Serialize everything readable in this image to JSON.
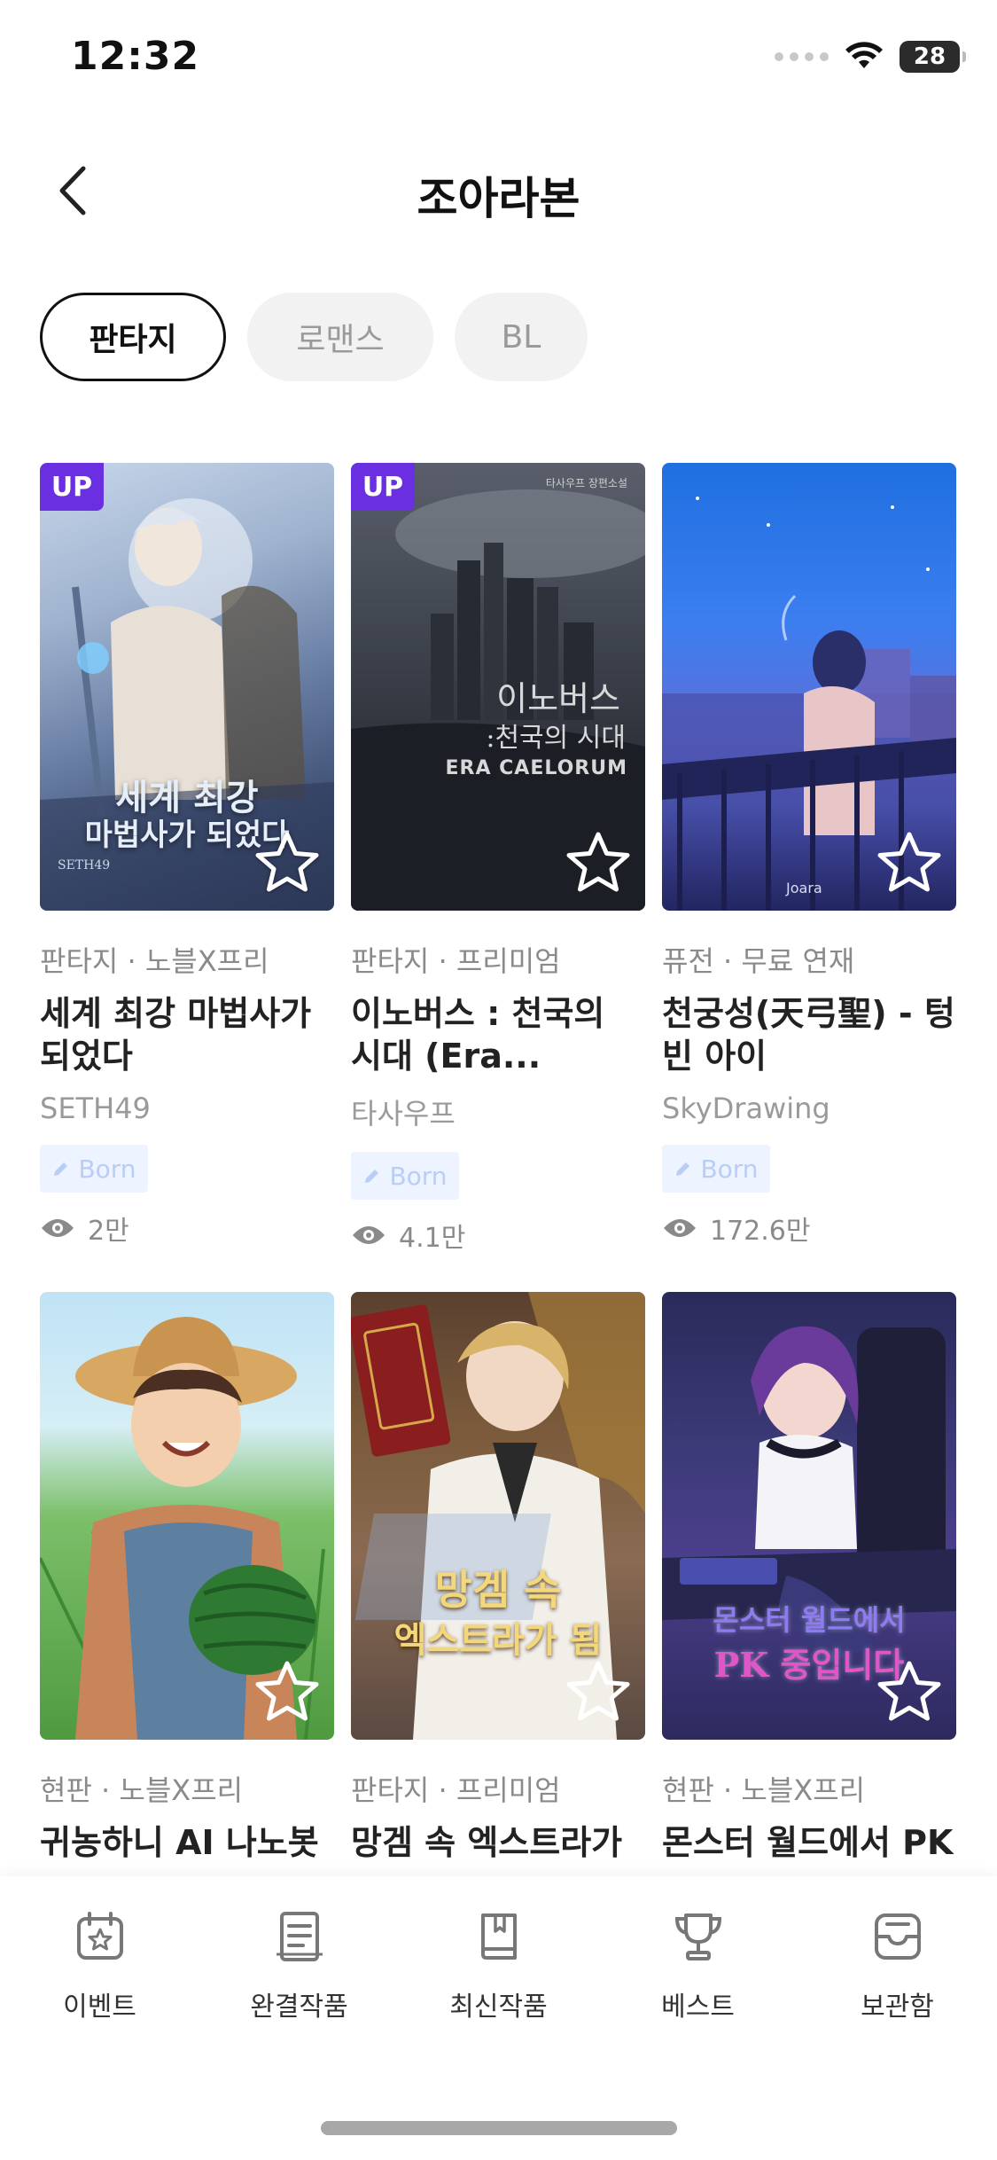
{
  "status_bar": {
    "time": "12:32",
    "battery": "28",
    "battery_level": 0.28
  },
  "header": {
    "title": "조아라본"
  },
  "tabs": [
    {
      "label": "판타지",
      "active": true
    },
    {
      "label": "로맨스",
      "active": false
    },
    {
      "label": "BL",
      "active": false
    }
  ],
  "books": [
    {
      "up": "UP",
      "cover_lines": [
        "세계 최강",
        "마법사가 되었다"
      ],
      "cover_credit": "SETH49",
      "meta": "판타지 · 노블X프리",
      "title": "세계 최강 마법사가 되었다",
      "author": "SETH49",
      "tag": "Born",
      "views": "2만"
    },
    {
      "up": "UP",
      "cover_lines": [
        "이노버스",
        ":천국의 시대",
        "ERA CAELORUM"
      ],
      "cover_credit": "타사우프 장편소설",
      "meta": "판타지 · 프리미엄",
      "title": "이노버스 : 천국의 시대 (Era...",
      "author": "타사우프",
      "tag": "Born",
      "views": "4.1만"
    },
    {
      "up": "",
      "cover_lines": [],
      "cover_credit": "Joara",
      "meta": "퓨전 · 무료 연재",
      "title": "천궁성(天弓聖) - 텅 빈 아이",
      "author": "SkyDrawing",
      "tag": "Born",
      "views": "172.6만"
    },
    {
      "up": "",
      "cover_lines": [],
      "cover_credit": "",
      "meta": "현판 · 노블X프리",
      "title": "귀농하니 AI 나노봇",
      "author": "",
      "tag": "",
      "views": ""
    },
    {
      "up": "",
      "cover_lines": [
        "망겜 속",
        "엑스트라가 됨"
      ],
      "cover_credit": "",
      "meta": "판타지 · 프리미엄",
      "title": "망겜 속 엑스트라가",
      "author": "",
      "tag": "",
      "views": ""
    },
    {
      "up": "",
      "cover_lines": [
        "몬스터 월드에서",
        "PK 중입니다"
      ],
      "cover_credit": "",
      "meta": "현판 · 노블X프리",
      "title": "몬스터 월드에서 PK",
      "author": "",
      "tag": "",
      "views": ""
    }
  ],
  "bottom_nav": [
    {
      "label": "이벤트",
      "icon": "calendar-star-icon"
    },
    {
      "label": "완결작품",
      "icon": "document-icon"
    },
    {
      "label": "최신작품",
      "icon": "book-icon"
    },
    {
      "label": "베스트",
      "icon": "trophy-icon"
    },
    {
      "label": "보관함",
      "icon": "inbox-icon"
    }
  ],
  "colors": {
    "up_badge": "#6a2fe0",
    "born_tag_bg": "#eef4ff",
    "born_tag_text": "#b9cdf6"
  }
}
